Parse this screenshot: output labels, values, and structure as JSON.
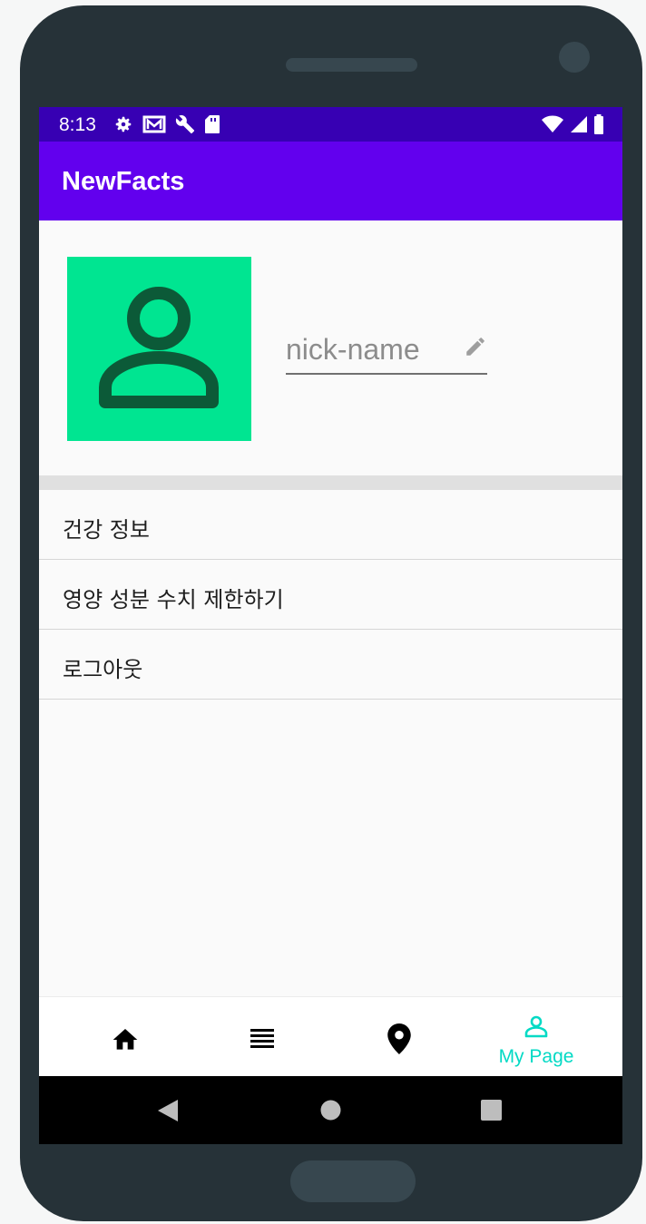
{
  "status_bar": {
    "time": "8:13",
    "left_icons": [
      "settings-icon",
      "mail-icon",
      "wrench-icon",
      "sd-card-icon"
    ],
    "right_icons": [
      "wifi-icon",
      "signal-icon",
      "battery-icon"
    ]
  },
  "app_bar": {
    "title": "NewFacts"
  },
  "profile": {
    "avatar_icon": "person-icon",
    "avatar_color": "#00e591",
    "nickname_placeholder": "nick-name",
    "nickname_value": ""
  },
  "menu": {
    "items": [
      {
        "label": "건강 정보"
      },
      {
        "label": "영양 성분 수치 제한하기"
      },
      {
        "label": "로그아웃"
      }
    ]
  },
  "bottom_nav": {
    "items": [
      {
        "icon": "home-icon",
        "label": ""
      },
      {
        "icon": "list-icon",
        "label": ""
      },
      {
        "icon": "location-icon",
        "label": ""
      },
      {
        "icon": "person-icon",
        "label": "My Page",
        "active": true
      }
    ],
    "active_color": "#03dac5"
  },
  "colors": {
    "status_bar": "#3700b3",
    "app_bar": "#6200ee"
  }
}
